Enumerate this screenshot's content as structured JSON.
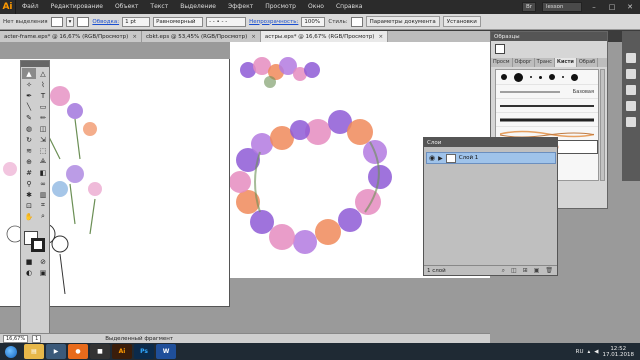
{
  "app": {
    "logo": "Ai"
  },
  "menu": [
    "Файл",
    "Редактирование",
    "Объект",
    "Текст",
    "Выделение",
    "Эффект",
    "Просмотр",
    "Окно",
    "Справка"
  ],
  "menubar_right": {
    "user": "lesson",
    "zoom_box": "Br",
    "window_icons": [
      "minimize-icon",
      "restore-icon",
      "close-icon"
    ]
  },
  "control": {
    "selection": "Нет выделения",
    "stroke_link": "Обводка:",
    "stroke_weight": "1 pt",
    "profile": "Равномерный",
    "opacity_link": "Непрозрачность:",
    "opacity_value": "100%",
    "style_label": "Стиль:",
    "doc_settings": "Параметры документа",
    "settings": "Установки"
  },
  "tabs": [
    {
      "label": "acter-frame.eps* @ 16,67% (RGB/Просмотр)",
      "active": false
    },
    {
      "label": "cbkt.eps @ 53,45% (RGB/Просмотр)",
      "active": false
    },
    {
      "label": "астры.eps* @ 16,67% (RGB/Просмотр)",
      "active": true
    }
  ],
  "samples_panel": {
    "title": "Образцы",
    "tabs": [
      "Просм",
      "Офорг",
      "Транс",
      "Кисти",
      "Обраб"
    ],
    "active_tab": "Кисти",
    "base_label": "Базовая"
  },
  "layers_panel": {
    "title": "Слои",
    "layer_name": "Слой 1",
    "count": "1 слой"
  },
  "status": {
    "zoom": "16,67%",
    "page": "1",
    "text": "Выделенный фрагмент"
  },
  "taskbar": {
    "lang": "RU",
    "time": "12:52",
    "date": "17.01.2018",
    "apps": [
      {
        "name": "explorer",
        "label": "▤",
        "bg": "#e7b84a"
      },
      {
        "name": "media",
        "label": "▶",
        "bg": "#3b5a7a"
      },
      {
        "name": "firefox",
        "label": "●",
        "bg": "#e86b1c"
      },
      {
        "name": "app-dark",
        "label": "■",
        "bg": "#333333"
      },
      {
        "name": "illustrator",
        "label": "Ai",
        "bg": "#3a1d0a"
      },
      {
        "name": "photoshop",
        "label": "Ps",
        "bg": "#0b2a4a"
      },
      {
        "name": "word",
        "label": "W",
        "bg": "#1f4f9a"
      }
    ]
  },
  "colors": {
    "accent": "#ff9a00",
    "flower_pink": "#e58cc0",
    "flower_purple": "#8e5ad6",
    "flower_orange": "#f08a5a",
    "leaf_green": "#6b8f55"
  }
}
